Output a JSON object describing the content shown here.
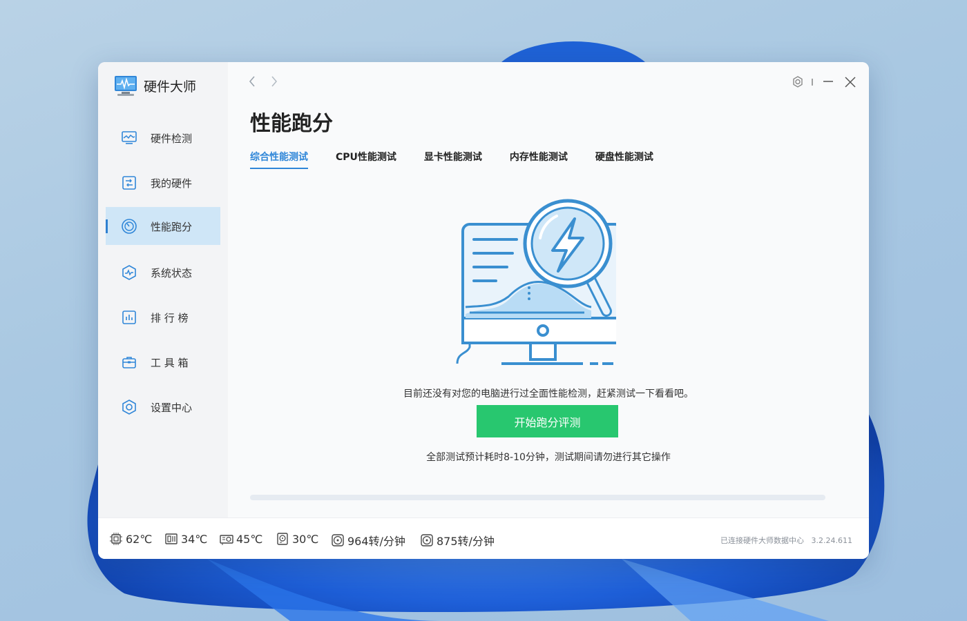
{
  "app": {
    "name": "硬件大师",
    "brand_icon": "monitor-pulse-icon"
  },
  "sidebar": {
    "items": [
      {
        "label": "硬件检测",
        "icon": "monitor-wave-icon",
        "active": false
      },
      {
        "label": "我的硬件",
        "icon": "hardware-chip-icon",
        "active": false
      },
      {
        "label": "性能跑分",
        "icon": "speedometer-icon",
        "active": true
      },
      {
        "label": "系统状态",
        "icon": "hexagon-pulse-icon",
        "active": false
      },
      {
        "label": "排 行 榜",
        "icon": "bar-chart-icon",
        "active": false
      },
      {
        "label": "工 具 箱",
        "icon": "toolbox-icon",
        "active": false
      },
      {
        "label": "设置中心",
        "icon": "hexagon-settings-icon",
        "active": false
      }
    ]
  },
  "header": {
    "back_icon": "chevron-left-icon",
    "forward_icon": "chevron-right-icon",
    "settings_icon": "gear-icon",
    "minimize_icon": "minimize-icon",
    "close_icon": "close-icon"
  },
  "main": {
    "title": "性能跑分",
    "tabs": [
      {
        "label": "综合性能测试",
        "active": true
      },
      {
        "label": "CPU性能测试",
        "active": false
      },
      {
        "label": "显卡性能测试",
        "active": false
      },
      {
        "label": "内存性能测试",
        "active": false
      },
      {
        "label": "硬盘性能测试",
        "active": false
      }
    ],
    "illustration": "monitor-magnifier-lightning-icon",
    "message": "目前还没有对您的电脑进行过全面性能检测，赶紧测试一下看看吧。",
    "start_button": "开始跑分评测",
    "note": "全部测试预计耗时8-10分钟，测试期间请勿进行其它操作",
    "progress": 0
  },
  "statusbar": {
    "stats": [
      {
        "icon": "cpu-icon",
        "value": "62℃"
      },
      {
        "icon": "motherboard-icon",
        "value": "34℃"
      },
      {
        "icon": "gpu-icon",
        "value": "45℃"
      },
      {
        "icon": "disk-icon",
        "value": "30℃"
      },
      {
        "icon": "fan-icon",
        "value": "964转/分钟"
      },
      {
        "icon": "fan-icon",
        "value": "875转/分钟"
      }
    ],
    "connection": "已连接硬件大师数据中心",
    "version": "3.2.24.611"
  },
  "colors": {
    "accent": "#2f86d8",
    "start_button": "#28c76f",
    "active_nav_bg": "#cfe6f7"
  }
}
